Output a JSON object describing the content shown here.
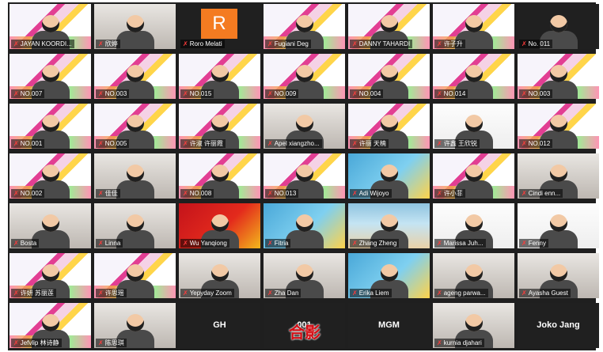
{
  "participants": [
    {
      "name": "JAYAN KOORDI...",
      "bg": "banner",
      "active": true
    },
    {
      "name": "欣婷",
      "bg": "room"
    },
    {
      "name": "Roro Melati",
      "bg": "dark",
      "initial": "R"
    },
    {
      "name": "Fugiani Deg",
      "bg": "banner"
    },
    {
      "name": "DANNY TAHARDI",
      "bg": "banner"
    },
    {
      "name": "许子升",
      "bg": "banner"
    },
    {
      "name": "No. 011",
      "bg": "dark"
    },
    {
      "name": "NO.007",
      "bg": "banner"
    },
    {
      "name": "NO.003",
      "bg": "banner"
    },
    {
      "name": "NO.015",
      "bg": "banner"
    },
    {
      "name": "NO.009",
      "bg": "banner"
    },
    {
      "name": "NO.004",
      "bg": "banner"
    },
    {
      "name": "NO.014",
      "bg": "banner"
    },
    {
      "name": "NO.003",
      "bg": "banner"
    },
    {
      "name": "NO.001",
      "bg": "banner"
    },
    {
      "name": "NO.005",
      "bg": "banner"
    },
    {
      "name": "许淑 许丽霞",
      "bg": "banner"
    },
    {
      "name": "Apel xiangzho...",
      "bg": "room"
    },
    {
      "name": "许丽 天楠",
      "bg": "banner"
    },
    {
      "name": "许鑫 王欣锐",
      "bg": "bright"
    },
    {
      "name": "NO.012",
      "bg": "banner"
    },
    {
      "name": "NO.002",
      "bg": "banner"
    },
    {
      "name": "佳佳",
      "bg": "room"
    },
    {
      "name": "NO.008",
      "bg": "banner"
    },
    {
      "name": "NO.013",
      "bg": "banner"
    },
    {
      "name": "Adi Wijoyo",
      "bg": "blue"
    },
    {
      "name": "许小菲",
      "bg": "banner"
    },
    {
      "name": "Cindi enn...",
      "bg": "room"
    },
    {
      "name": "Bosta",
      "bg": "room"
    },
    {
      "name": "Linna",
      "bg": "room"
    },
    {
      "name": "Wu Yanqiong",
      "bg": "red"
    },
    {
      "name": "Fitria",
      "bg": "blue"
    },
    {
      "name": "Zhang Zheng",
      "bg": "beach"
    },
    {
      "name": "Marissa Juh...",
      "bg": "bright"
    },
    {
      "name": "Fenny",
      "bg": "bright"
    },
    {
      "name": "许妍 苏丽莲",
      "bg": "banner"
    },
    {
      "name": "许思瑶",
      "bg": "banner"
    },
    {
      "name": "Yepyday Zoom",
      "bg": "room"
    },
    {
      "name": "Zha Dan",
      "bg": "room"
    },
    {
      "name": "Erika Liem",
      "bg": "blue"
    },
    {
      "name": "ageng parwa...",
      "bg": "room"
    },
    {
      "name": "Ayasha Guest",
      "bg": "room"
    },
    {
      "name": "Jefvlip 林诗静",
      "bg": "banner"
    },
    {
      "name": "陈思琪",
      "bg": "room"
    },
    {
      "name": "GH",
      "bg": "dark",
      "big": true
    },
    {
      "name": "001",
      "bg": "dark",
      "big": true
    },
    {
      "name": "MGM",
      "bg": "dark",
      "big": true
    },
    {
      "name": "kurnia djahari",
      "bg": "room"
    },
    {
      "name": "Joko Jang",
      "bg": "dark",
      "big": true
    }
  ],
  "overlay": {
    "caption": "合影"
  },
  "icons": {
    "muted": "mic-muted-icon"
  },
  "colors": {
    "active_outline": "#d6f04a",
    "muted": "#ff3b3b",
    "caption": "#d40b12"
  }
}
